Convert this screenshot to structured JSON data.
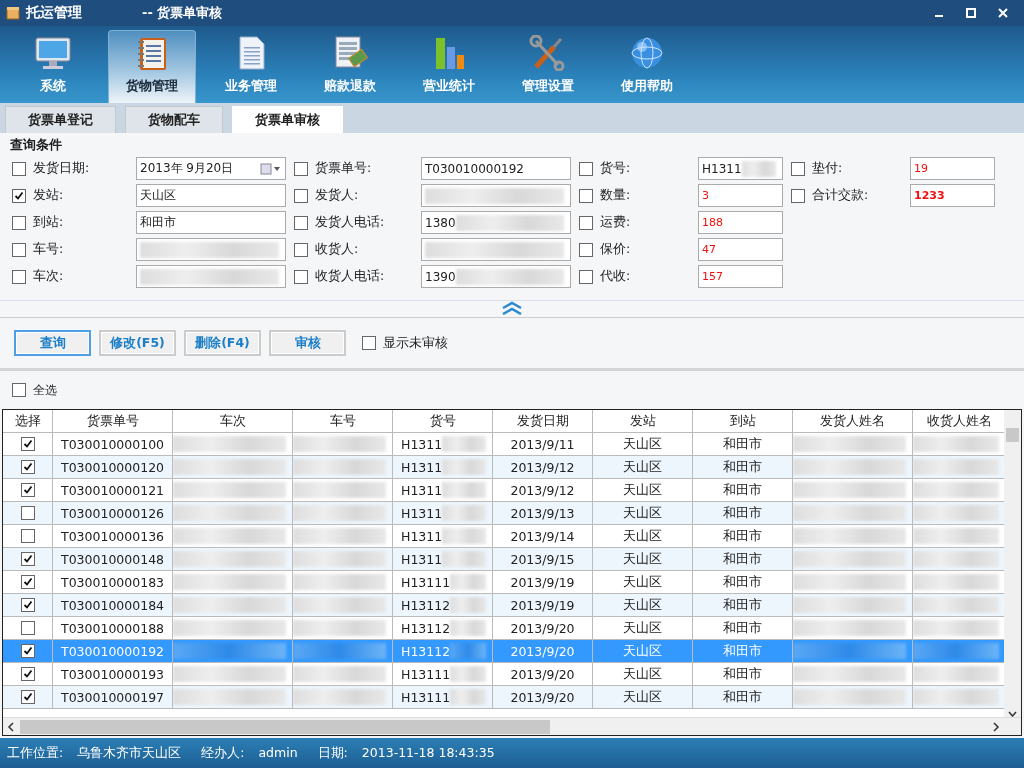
{
  "window": {
    "app_title": "托运管理",
    "page_title": "-- 货票单审核"
  },
  "modules": [
    {
      "label": "系统",
      "selected": false
    },
    {
      "label": "货物管理",
      "selected": true
    },
    {
      "label": "业务管理",
      "selected": false
    },
    {
      "label": "赔款退款",
      "selected": false
    },
    {
      "label": "营业统计",
      "selected": false
    },
    {
      "label": "管理设置",
      "selected": false
    },
    {
      "label": "使用帮助",
      "selected": false
    }
  ],
  "subtabs": [
    {
      "label": "货票单登记",
      "selected": false
    },
    {
      "label": "货物配车",
      "selected": false
    },
    {
      "label": "货票单审核",
      "selected": true
    }
  ],
  "query": {
    "title": "查询条件",
    "columns": [
      [
        {
          "label": "发货日期:",
          "checked": false,
          "kind": "date",
          "value": "2013年  9月20日"
        },
        {
          "label": "发站:",
          "checked": true,
          "kind": "text",
          "value": "天山区"
        },
        {
          "label": "到站:",
          "checked": false,
          "kind": "text",
          "value": "和田市"
        },
        {
          "label": "车号:",
          "checked": false,
          "kind": "text",
          "redacted": true
        },
        {
          "label": "车次:",
          "checked": false,
          "kind": "text",
          "redacted": true
        }
      ],
      [
        {
          "label": "货票单号:",
          "checked": false,
          "kind": "text",
          "value": "T030010000192"
        },
        {
          "label": "发货人:",
          "checked": false,
          "kind": "text",
          "redacted": true
        },
        {
          "label": "发货人电话:",
          "checked": false,
          "kind": "text",
          "value": "1380",
          "redacted": true
        },
        {
          "label": "收货人:",
          "checked": false,
          "kind": "text",
          "redacted": true
        },
        {
          "label": "收货人电话:",
          "checked": false,
          "kind": "text",
          "value": "1390",
          "redacted": true
        }
      ],
      [
        {
          "label": "货号:",
          "checked": false,
          "kind": "text",
          "value": "H1311",
          "redacted": true
        },
        {
          "label": "数量:",
          "checked": false,
          "kind": "money",
          "value": "3"
        },
        {
          "label": "运费:",
          "checked": false,
          "kind": "money",
          "value": "188"
        },
        {
          "label": "保价:",
          "checked": false,
          "kind": "money",
          "value": "47"
        },
        {
          "label": "代收:",
          "checked": false,
          "kind": "money",
          "value": "157"
        }
      ],
      [
        {
          "label": "垫付:",
          "checked": false,
          "kind": "money",
          "value": "19"
        },
        {
          "label": "合计交款:",
          "checked": false,
          "kind": "total",
          "value": "1233"
        }
      ]
    ]
  },
  "actions": [
    "查询",
    "修改(F5)",
    "删除(F4)",
    "审核"
  ],
  "show_unaudited": {
    "label": "显示未审核",
    "checked": false
  },
  "select_all": {
    "label": "全选",
    "checked": false
  },
  "table": {
    "columns": [
      "选择",
      "货票单号",
      "车次",
      "车号",
      "货号",
      "发货日期",
      "发站",
      "到站",
      "发货人姓名",
      "收货人姓名"
    ],
    "rows": [
      {
        "checked": true,
        "selected": false,
        "number": "T030010000100",
        "goods": "H1311",
        "date": "2013/9/11",
        "from": "天山区",
        "to": "和田市"
      },
      {
        "checked": true,
        "selected": false,
        "number": "T030010000120",
        "goods": "H1311",
        "date": "2013/9/12",
        "from": "天山区",
        "to": "和田市"
      },
      {
        "checked": true,
        "selected": false,
        "number": "T030010000121",
        "goods": "H1311",
        "date": "2013/9/12",
        "from": "天山区",
        "to": "和田市"
      },
      {
        "checked": false,
        "selected": false,
        "number": "T030010000126",
        "goods": "H1311",
        "date": "2013/9/13",
        "from": "天山区",
        "to": "和田市"
      },
      {
        "checked": false,
        "selected": false,
        "number": "T030010000136",
        "goods": "H1311",
        "date": "2013/9/14",
        "from": "天山区",
        "to": "和田市"
      },
      {
        "checked": true,
        "selected": false,
        "number": "T030010000148",
        "goods": "H1311",
        "date": "2013/9/15",
        "from": "天山区",
        "to": "和田市"
      },
      {
        "checked": true,
        "selected": false,
        "number": "T030010000183",
        "goods": "H13111",
        "date": "2013/9/19",
        "from": "天山区",
        "to": "和田市"
      },
      {
        "checked": true,
        "selected": false,
        "number": "T030010000184",
        "goods": "H13112",
        "date": "2013/9/19",
        "from": "天山区",
        "to": "和田市"
      },
      {
        "checked": false,
        "selected": false,
        "number": "T030010000188",
        "goods": "H13112",
        "date": "2013/9/20",
        "from": "天山区",
        "to": "和田市"
      },
      {
        "checked": true,
        "selected": true,
        "number": "T030010000192",
        "goods": "H13112",
        "date": "2013/9/20",
        "from": "天山区",
        "to": "和田市"
      },
      {
        "checked": true,
        "selected": false,
        "number": "T030010000193",
        "goods": "H13111",
        "date": "2013/9/20",
        "from": "天山区",
        "to": "和田市"
      },
      {
        "checked": true,
        "selected": false,
        "number": "T030010000197",
        "goods": "H13111",
        "date": "2013/9/20",
        "from": "天山区",
        "to": "和田市"
      }
    ]
  },
  "status_bar": [
    {
      "label": "工作位置:",
      "value": "乌鲁木齐市天山区"
    },
    {
      "label": "经办人:",
      "value": "admin"
    },
    {
      "label": "日期:",
      "value": "2013-11-18 18:43:35"
    }
  ]
}
